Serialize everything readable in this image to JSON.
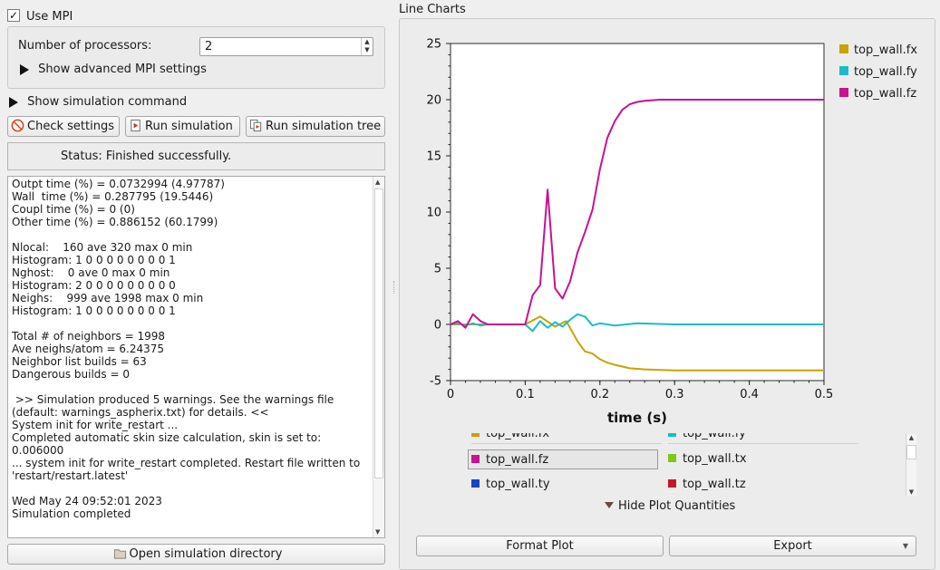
{
  "mpi": {
    "use_mpi_label": "Use MPI",
    "use_mpi_checked": true,
    "processors_label": "Number of processors:",
    "processors_value": "2",
    "advanced_label": "Show advanced MPI settings"
  },
  "sim_command_label": "Show simulation command",
  "buttons": {
    "check_settings": "Check settings",
    "run_simulation": "Run simulation",
    "run_simulation_tree": "Run simulation tree",
    "open_directory": "Open simulation directory"
  },
  "status": "Status: Finished successfully.",
  "log": [
    "Outpt time (%) = 0.0732994 (4.97787)",
    "Wall  time (%) = 0.287795 (19.5446)",
    "Coupl time (%) = 0 (0)",
    "Other time (%) = 0.886152 (60.1799)",
    "",
    "Nlocal:    160 ave 320 max 0 min",
    "Histogram: 1 0 0 0 0 0 0 0 0 1",
    "Nghost:    0 ave 0 max 0 min",
    "Histogram: 2 0 0 0 0 0 0 0 0 0",
    "Neighs:    999 ave 1998 max 0 min",
    "Histogram: 1 0 0 0 0 0 0 0 0 1",
    "",
    "Total # of neighbors = 1998",
    "Ave neighs/atom = 6.24375",
    "Neighbor list builds = 63",
    "Dangerous builds = 0",
    "",
    " >> Simulation produced 5 warnings. See the warnings file",
    "(default: warnings_aspherix.txt) for details. <<",
    "System init for write_restart ...",
    "Completed automatic skin size calculation, skin is set to:",
    "0.006000",
    "... system init for write_restart completed. Restart file written to",
    "'restart/restart.latest'",
    "",
    "Wed May 24 09:52:01 2023",
    "Simulation completed"
  ],
  "line_charts_title": "Line Charts",
  "quantities": {
    "items": [
      {
        "label": "top_wall.fx",
        "color": "#c8a200"
      },
      {
        "label": "top_wall.fy",
        "color": "#1bbcc8"
      },
      {
        "label": "top_wall.fz",
        "color": "#c8128e"
      },
      {
        "label": "top_wall.tx",
        "color": "#7cc81e"
      },
      {
        "label": "top_wall.ty",
        "color": "#1445c8"
      },
      {
        "label": "top_wall.tz",
        "color": "#c81424"
      }
    ],
    "hide_label": "Hide Plot Quantities"
  },
  "format_plot_label": "Format Plot",
  "export_label": "Export",
  "chart_data": {
    "type": "line",
    "xlabel": "time (s)",
    "ylabel": "",
    "xlim": [
      0,
      0.5
    ],
    "ylim": [
      -5,
      25
    ],
    "xticks": [
      "0",
      "0.1",
      "0.2",
      "0.3",
      "0.4",
      "0.5"
    ],
    "yticks": [
      "-5",
      "0",
      "5",
      "10",
      "15",
      "20",
      "25"
    ],
    "legend_position": "right",
    "series": [
      {
        "name": "top_wall.fx",
        "color": "#c8a200",
        "x": [
          0,
          0.1,
          0.12,
          0.14,
          0.155,
          0.17,
          0.18,
          0.19,
          0.2,
          0.21,
          0.22,
          0.24,
          0.26,
          0.3,
          0.4,
          0.5
        ],
        "y": [
          0,
          0,
          0.7,
          -0.2,
          0.3,
          -1.5,
          -2.4,
          -2.6,
          -3.1,
          -3.4,
          -3.6,
          -3.9,
          -4.0,
          -4.1,
          -4.1,
          -4.1
        ]
      },
      {
        "name": "top_wall.fy",
        "color": "#1bbcc8",
        "x": [
          0,
          0.1,
          0.11,
          0.12,
          0.13,
          0.14,
          0.15,
          0.16,
          0.17,
          0.18,
          0.19,
          0.2,
          0.22,
          0.25,
          0.3,
          0.4,
          0.5
        ],
        "y": [
          0,
          0,
          -0.6,
          0.3,
          -0.3,
          0.2,
          -0.2,
          0.4,
          0.9,
          0.7,
          -0.1,
          0.1,
          -0.1,
          0.1,
          0,
          0,
          0
        ],
        "note_extra_x": [
          0,
          0.01,
          0.02,
          0.03,
          0.04,
          0.05
        ],
        "note_extra_y": [
          0,
          0.1,
          -0.1,
          0.1,
          -0.1,
          0
        ]
      },
      {
        "name": "top_wall.fz",
        "color": "#c8128e",
        "x": [
          0,
          0.01,
          0.02,
          0.03,
          0.04,
          0.05,
          0.1,
          0.11,
          0.12,
          0.13,
          0.14,
          0.15,
          0.16,
          0.17,
          0.18,
          0.19,
          0.2,
          0.21,
          0.22,
          0.23,
          0.24,
          0.25,
          0.26,
          0.28,
          0.3,
          0.35,
          0.4,
          0.5
        ],
        "y": [
          0,
          0.3,
          -0.3,
          0.9,
          0.3,
          0,
          0,
          2.6,
          3.5,
          12.0,
          3.2,
          2.3,
          3.8,
          6.4,
          8.2,
          10.2,
          13.8,
          16.6,
          18.1,
          19.1,
          19.6,
          19.8,
          19.9,
          20.0,
          20.0,
          20.0,
          20.0,
          20.0
        ]
      }
    ]
  }
}
